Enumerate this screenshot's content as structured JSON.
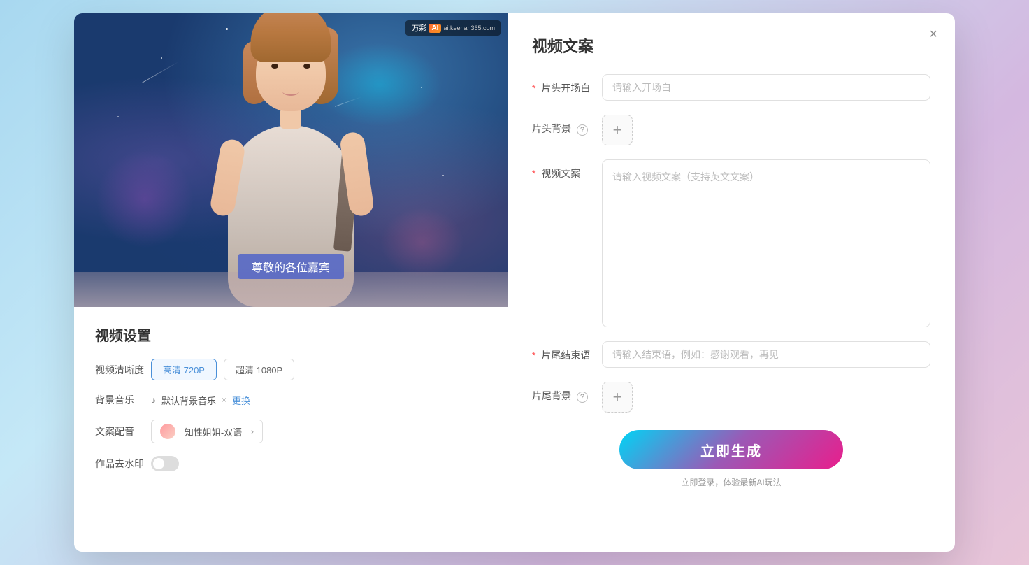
{
  "modal": {
    "close_label": "×",
    "left": {
      "subtitle": "尊敬的各位嘉宾",
      "watermark_text": "万彩",
      "watermark_ai": "AI",
      "watermark_sub": "ai.keehan365.com",
      "settings_title": "视频设置",
      "resolution_label": "视频清晰度",
      "resolution_options": [
        {
          "label": "高清 720P",
          "active": true
        },
        {
          "label": "超清 1080P",
          "active": false
        }
      ],
      "music_label": "背景音乐",
      "music_name": "默认背景音乐",
      "music_change": "更换",
      "voice_label": "文案配音",
      "voice_name": "知性姐姐-双语",
      "watermark_label": "作品去水印"
    },
    "right": {
      "title": "视频文案",
      "opening_label": "片头开场白",
      "opening_placeholder": "请输入开场白",
      "opening_required": true,
      "bg_label": "片头背景",
      "bg_add": "+",
      "content_label": "视频文案",
      "content_placeholder": "请输入视频文案（支持英文文案）",
      "content_required": true,
      "ending_label": "片尾结束语",
      "ending_placeholder": "请输入结束语，例如：感谢观看，再见",
      "ending_required": true,
      "ending_bg_label": "片尾背景",
      "ending_bg_add": "+",
      "generate_btn": "立即生成",
      "login_hint": "立即登录，体验最新AI玩法"
    }
  }
}
